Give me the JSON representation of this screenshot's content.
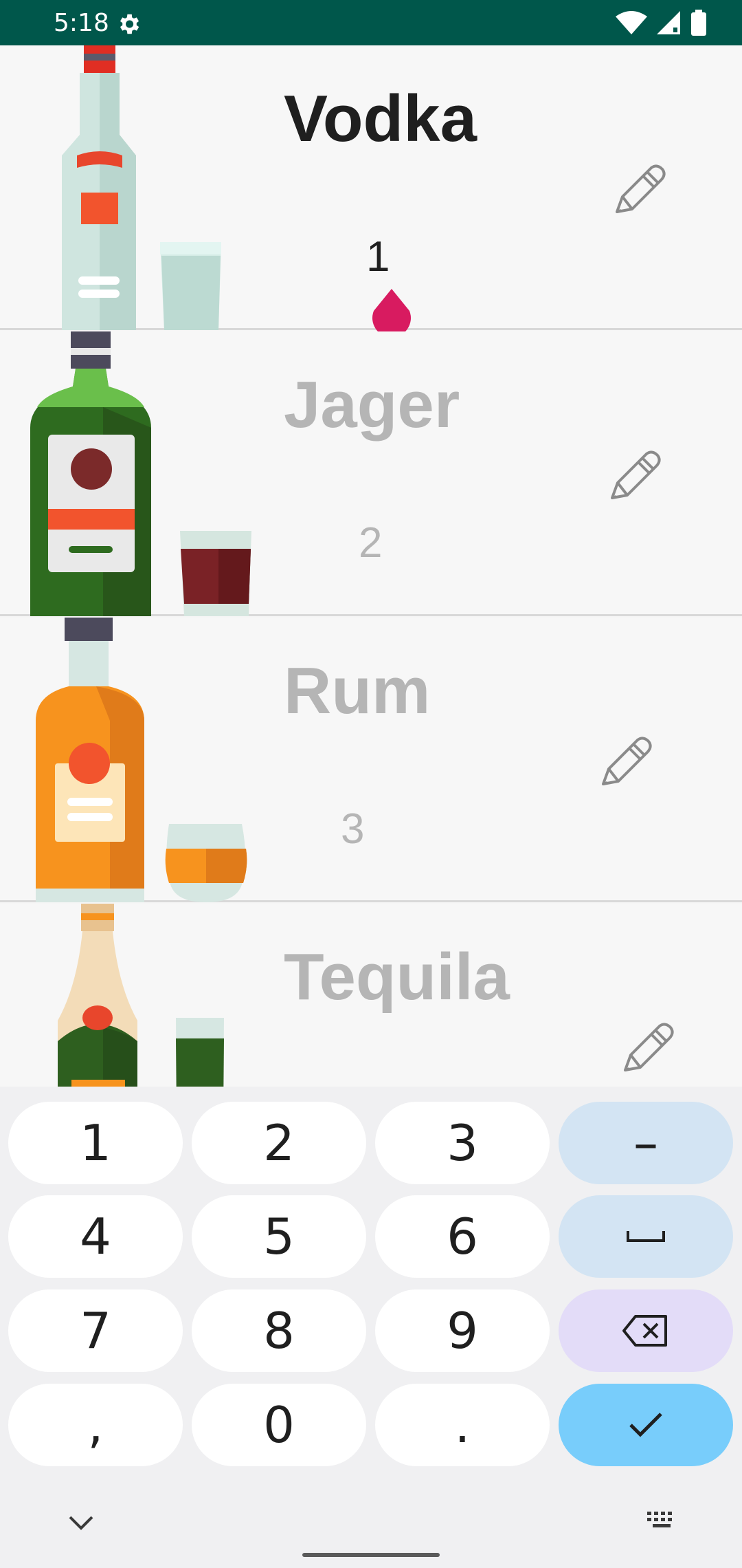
{
  "status_bar": {
    "time": "5:18",
    "icons": [
      "settings-gear-icon",
      "wifi-icon",
      "cellular-signal-icon",
      "battery-icon"
    ]
  },
  "drinks": [
    {
      "name": "Vodka",
      "count": "1",
      "selected": true,
      "icon": "vodka-bottle-icon",
      "glass_icon": "shot-glass-icon"
    },
    {
      "name": "Jager",
      "count": "2",
      "selected": false,
      "icon": "jager-bottle-icon",
      "glass_icon": "shot-glass-icon"
    },
    {
      "name": "Rum",
      "count": "3",
      "selected": false,
      "icon": "rum-bottle-icon",
      "glass_icon": "tumbler-glass-icon"
    },
    {
      "name": "Tequila",
      "count": "",
      "selected": false,
      "icon": "tequila-bottle-icon",
      "glass_icon": "shot-glass-icon"
    }
  ],
  "edit_icon": "pencil-icon",
  "cursor_icon": "text-cursor-drop-icon",
  "keyboard": {
    "rows": [
      [
        "1",
        "2",
        "3",
        "–"
      ],
      [
        "4",
        "5",
        "6",
        "␣"
      ],
      [
        "7",
        "8",
        "9",
        "⌫"
      ],
      [
        ",",
        "0",
        ".",
        "✓"
      ]
    ],
    "collapse_icon": "chevron-down-icon",
    "switch_icon": "keyboard-icon"
  },
  "colors": {
    "status_bar": "#00574b",
    "accent": "#d81b60",
    "selected_text": "#1f1f1f",
    "inactive_text": "#b5b5b5",
    "enter_key": "#78cdfb"
  }
}
